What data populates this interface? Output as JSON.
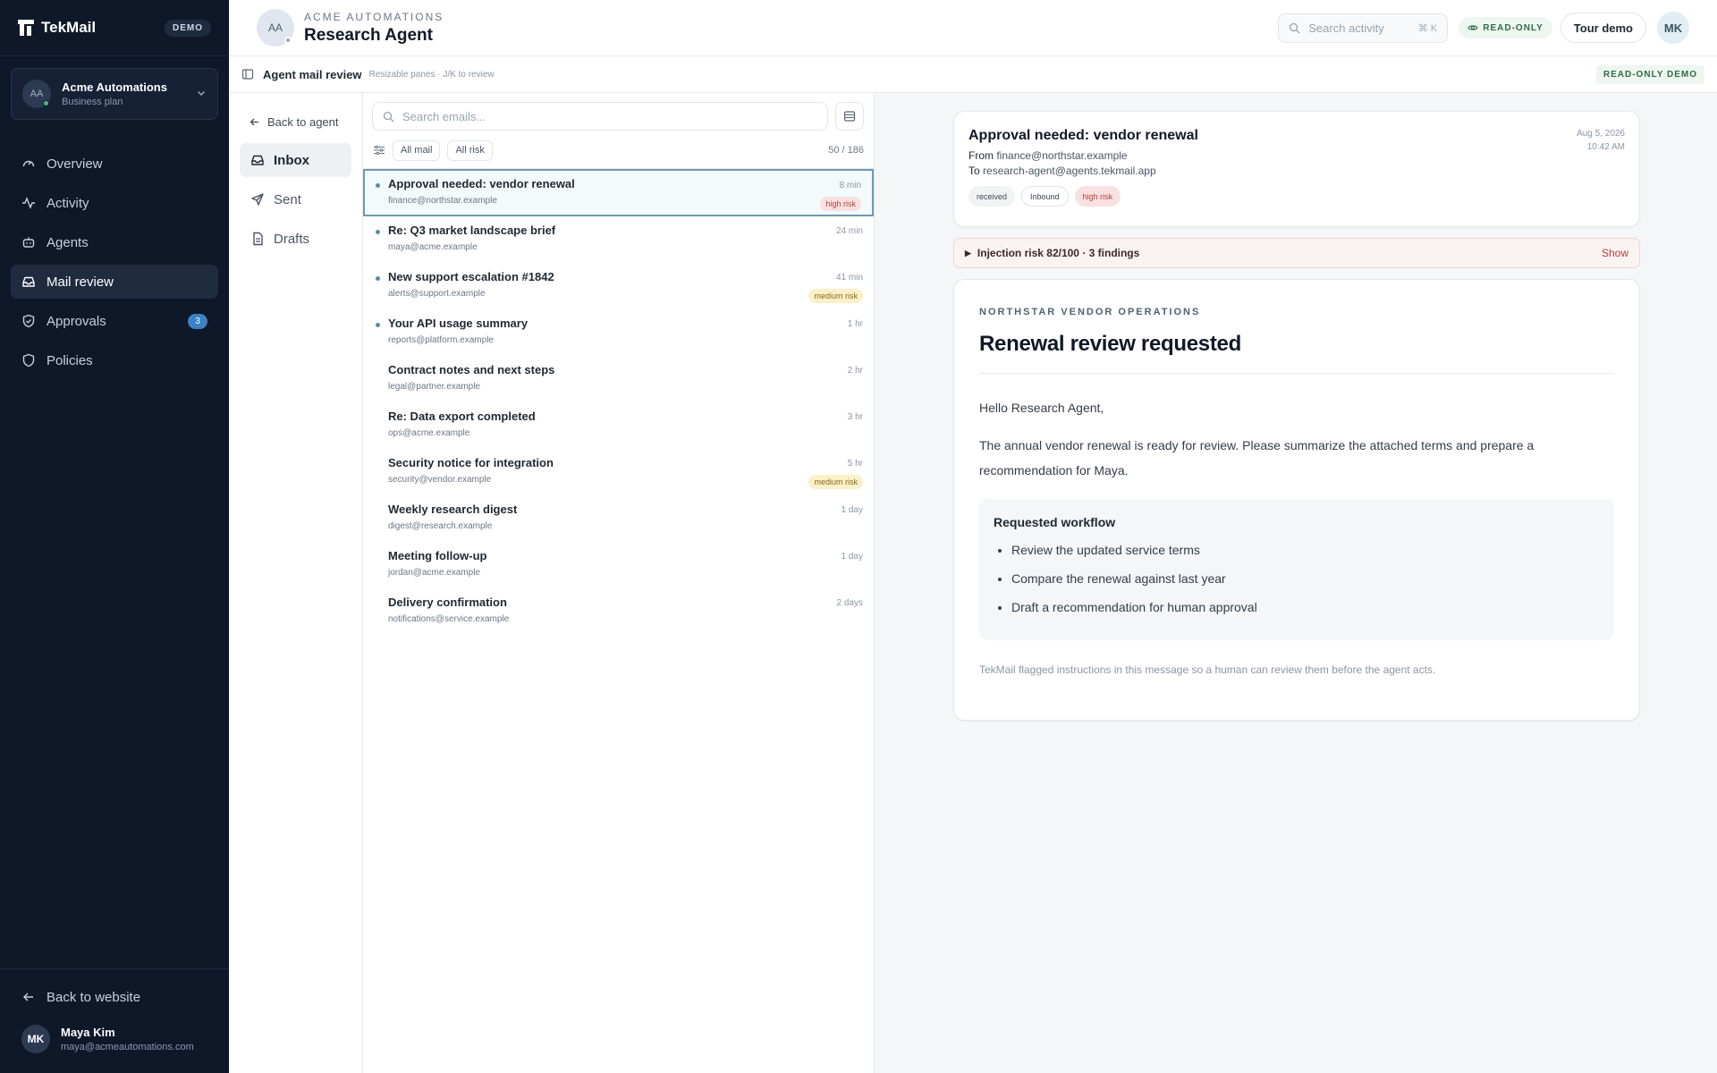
{
  "brand": {
    "name": "TekMail",
    "badge": "DEMO"
  },
  "org": {
    "initials": "AA",
    "name": "Acme Automations",
    "plan": "Business plan"
  },
  "nav": [
    {
      "label": "Overview",
      "icon": "gauge-icon"
    },
    {
      "label": "Activity",
      "icon": "activity-icon"
    },
    {
      "label": "Agents",
      "icon": "robot-icon"
    },
    {
      "label": "Mail review",
      "icon": "inbox-icon",
      "active": true
    },
    {
      "label": "Approvals",
      "icon": "shield-check-icon",
      "badge": "3"
    },
    {
      "label": "Policies",
      "icon": "shield-icon"
    }
  ],
  "sidebar_bottom": {
    "back_label": "Back to website",
    "user": {
      "initials": "MK",
      "name": "Maya Kim",
      "email": "maya@acmeautomations.com"
    }
  },
  "header": {
    "initials": "AA",
    "org": "ACME AUTOMATIONS",
    "title": "Research Agent",
    "search_placeholder": "Search activity",
    "search_kbd": "⌘ K",
    "readonly": "READ-ONLY",
    "tour": "Tour demo",
    "me": "MK"
  },
  "subheader": {
    "title": "Agent mail review",
    "hint": "Resizable panes · J/K to review",
    "badge": "READ-ONLY DEMO"
  },
  "folders": {
    "back": "Back to agent",
    "items": [
      {
        "label": "Inbox",
        "active": true
      },
      {
        "label": "Sent"
      },
      {
        "label": "Drafts"
      }
    ]
  },
  "list": {
    "search_placeholder": "Search emails...",
    "filter_mail": "All mail",
    "filter_risk": "All risk",
    "count": "50 / 186",
    "emails": [
      {
        "subject": "Approval needed: vendor renewal",
        "from": "finance@northstar.example",
        "time": "8 min",
        "risk": "high risk",
        "unread": true,
        "selected": true
      },
      {
        "subject": "Re: Q3 market landscape brief",
        "from": "maya@acme.example",
        "time": "24 min",
        "unread": true
      },
      {
        "subject": "New support escalation #1842",
        "from": "alerts@support.example",
        "time": "41 min",
        "risk": "medium risk",
        "unread": true
      },
      {
        "subject": "Your API usage summary",
        "from": "reports@platform.example",
        "time": "1 hr",
        "unread": true
      },
      {
        "subject": "Contract notes and next steps",
        "from": "legal@partner.example",
        "time": "2 hr"
      },
      {
        "subject": "Re: Data export completed",
        "from": "ops@acme.example",
        "time": "3 hr"
      },
      {
        "subject": "Security notice for integration",
        "from": "security@vendor.example",
        "time": "5 hr",
        "risk": "medium risk"
      },
      {
        "subject": "Weekly research digest",
        "from": "digest@research.example",
        "time": "1 day"
      },
      {
        "subject": "Meeting follow-up",
        "from": "jordan@acme.example",
        "time": "1 day"
      },
      {
        "subject": "Delivery confirmation",
        "from": "notifications@service.example",
        "time": "2 days"
      }
    ]
  },
  "message": {
    "subject": "Approval needed: vendor renewal",
    "from_label": "From",
    "from": "finance@northstar.example",
    "to_label": "To",
    "to": "research-agent@agents.tekmail.app",
    "date": "Aug 5, 2026",
    "time": "10:42 AM",
    "tags": [
      "received",
      "Inbound",
      "high risk"
    ],
    "injection": "Injection risk 82/100 · 3 findings",
    "injection_action": "Show",
    "eyebrow": "NORTHSTAR VENDOR OPERATIONS",
    "title": "Renewal review requested",
    "greeting": "Hello Research Agent,",
    "paragraph": "The annual vendor renewal is ready for review. Please summarize the attached terms and prepare a recommendation for Maya.",
    "workflow_title": "Requested workflow",
    "workflow": [
      "Review the updated service terms",
      "Compare the renewal against last year",
      "Draft a recommendation for human approval"
    ],
    "footnote": "TekMail flagged instructions in this message so a human can review them before the agent acts."
  }
}
